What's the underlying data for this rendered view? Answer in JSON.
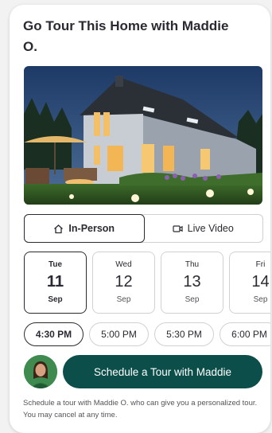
{
  "heading": "Go Tour This Home with Maddie O.",
  "tour_types": [
    {
      "label": "In-Person",
      "icon": "home-icon",
      "selected": true
    },
    {
      "label": "Live Video",
      "icon": "video-camera-icon",
      "selected": false
    }
  ],
  "dates": [
    {
      "weekday": "Tue",
      "day": "11",
      "month": "Sep",
      "selected": true
    },
    {
      "weekday": "Wed",
      "day": "12",
      "month": "Sep",
      "selected": false
    },
    {
      "weekday": "Thu",
      "day": "13",
      "month": "Sep",
      "selected": false
    },
    {
      "weekday": "Fri",
      "day": "14",
      "month": "Sep",
      "selected": false
    }
  ],
  "times": [
    {
      "label": "4:30 PM",
      "selected": true
    },
    {
      "label": "5:00 PM",
      "selected": false
    },
    {
      "label": "5:30 PM",
      "selected": false
    },
    {
      "label": "6:00 PM",
      "selected": false
    }
  ],
  "cta_label": "Schedule a Tour with Maddie",
  "disclaimer": "Schedule a tour with Maddie O. who can give you a personalized tour. You may cancel at any time.",
  "colors": {
    "cta": "#0b4e4a",
    "text": "#2a2a33",
    "border": "#d1d1d5"
  }
}
